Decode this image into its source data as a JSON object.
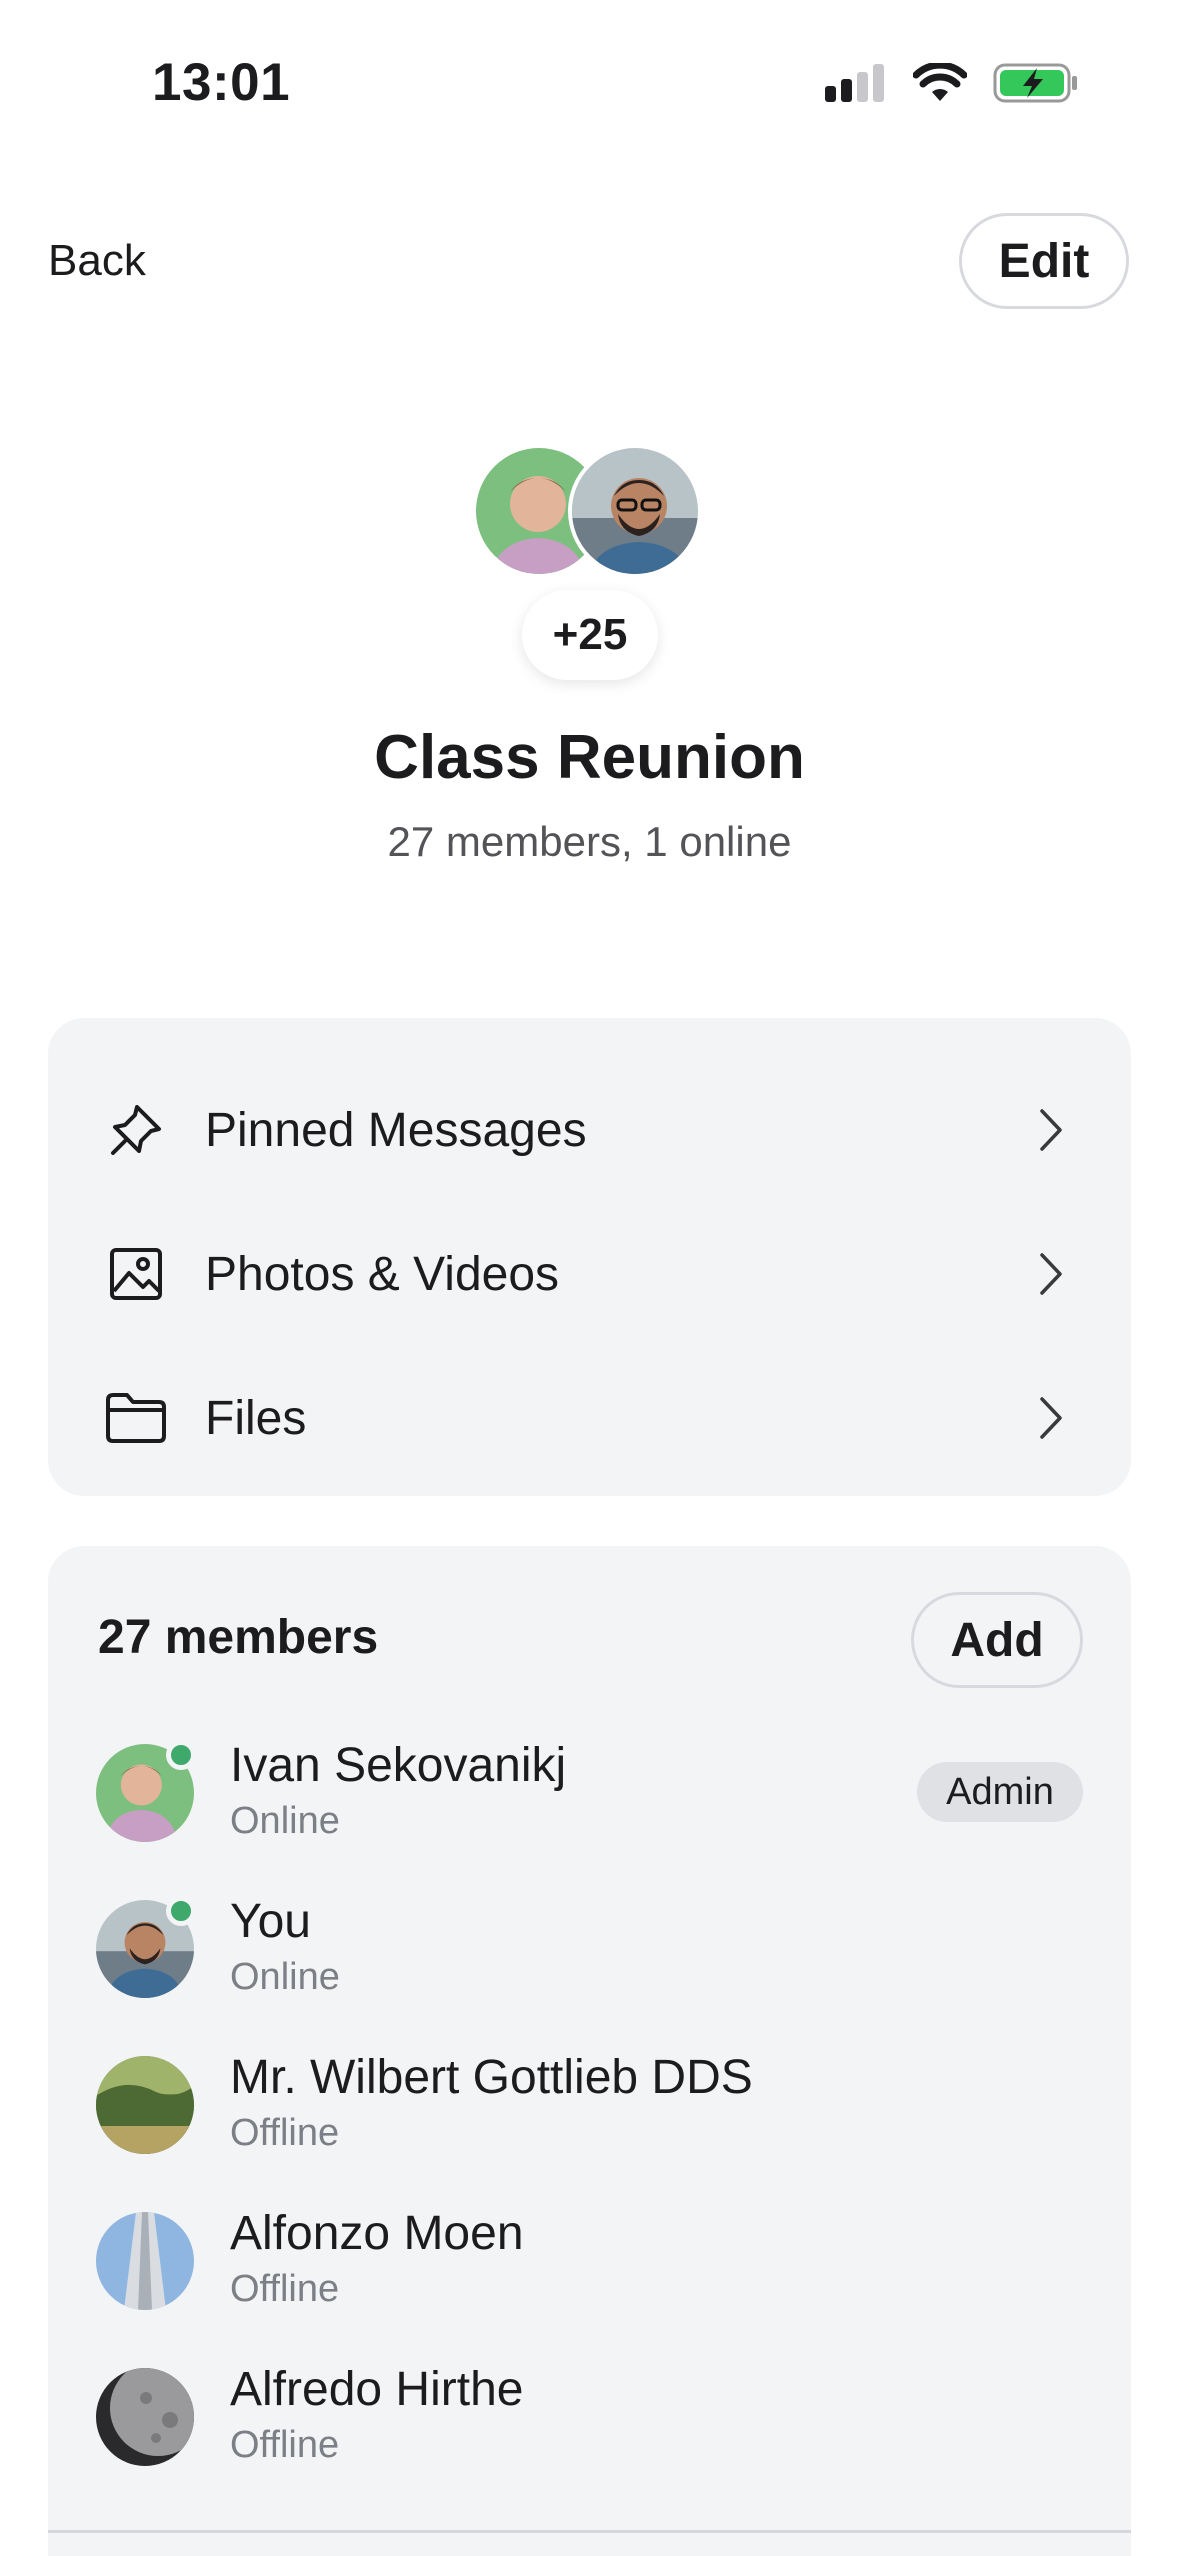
{
  "status_bar": {
    "time": "13:01"
  },
  "nav": {
    "back_label": "Back",
    "edit_label": "Edit"
  },
  "group": {
    "more_count": "+25",
    "title": "Class Reunion",
    "subtitle": "27 members, 1 online"
  },
  "links": [
    {
      "label": "Pinned Messages",
      "icon": "pin-icon"
    },
    {
      "label": "Photos & Videos",
      "icon": "image-icon"
    },
    {
      "label": "Files",
      "icon": "folder-icon"
    }
  ],
  "members": {
    "title": "27 members",
    "add_label": "Add",
    "list": [
      {
        "name": "Ivan Sekovanikj",
        "status": "Online",
        "badge": "Admin"
      },
      {
        "name": "You",
        "status": "Online"
      },
      {
        "name": "Mr. Wilbert Gottlieb DDS",
        "status": "Offline"
      },
      {
        "name": "Alfonzo Moen",
        "status": "Offline"
      },
      {
        "name": "Alfredo Hirthe",
        "status": "Offline"
      }
    ]
  },
  "colors": {
    "online_dot": "#3fa86b",
    "card_background": "#f3f4f6",
    "battery_fill": "#34c759"
  }
}
